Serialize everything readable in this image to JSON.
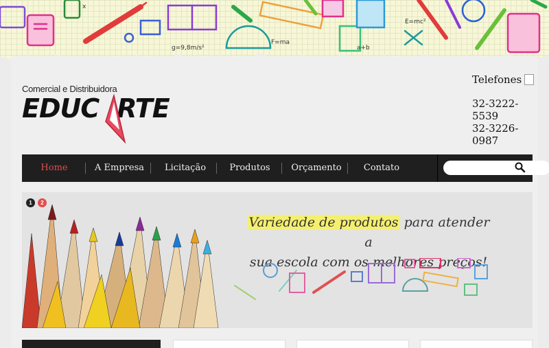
{
  "brand": {
    "line1": "Comercial e Distribuidora",
    "name_left": "EDUC",
    "name_right": "RTE"
  },
  "contact": {
    "title": "Telefones",
    "phones": [
      "32-3222-5539",
      "32-3226-0987"
    ]
  },
  "nav": {
    "items": [
      {
        "label": "Home",
        "active": true
      },
      {
        "label": "A Empresa"
      },
      {
        "label": "Licitação"
      },
      {
        "label": "Produtos"
      },
      {
        "label": "Orçamento"
      },
      {
        "label": "Contato"
      }
    ],
    "search_placeholder": ""
  },
  "slider": {
    "dots": [
      "1",
      "2"
    ],
    "active_dot": 2,
    "highlight": "Variedade de produtos",
    "text_rest_1": " para atender a",
    "text_line2": "sua escola com os melhores preços!"
  },
  "colors": {
    "accent": "#e64b4b",
    "nav_bg": "#1f1f1f",
    "highlight": "#f5ef6f"
  }
}
